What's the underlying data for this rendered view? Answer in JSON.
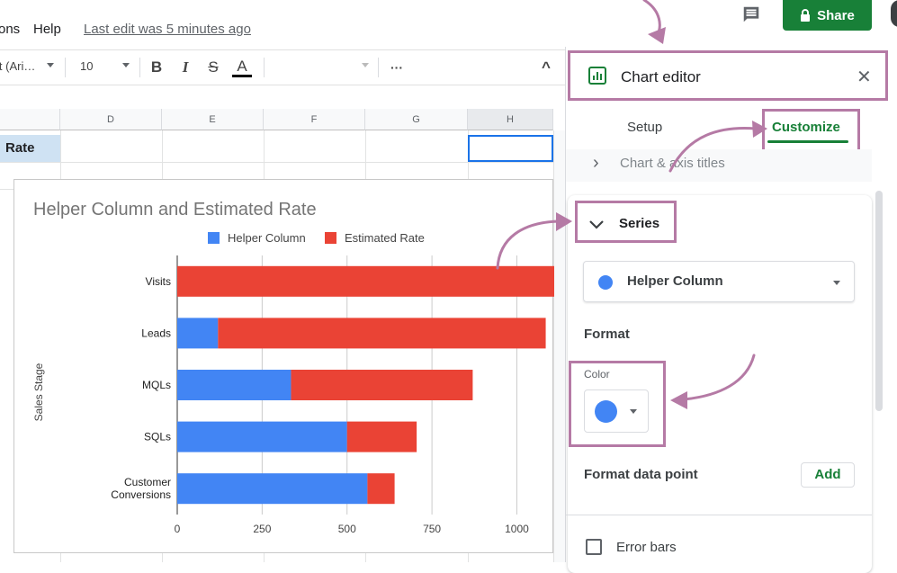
{
  "menu": {
    "item_ons": "ons",
    "item_help": "Help",
    "last_edit": "Last edit was 5 minutes ago"
  },
  "header": {
    "share_label": "Share"
  },
  "toolbar": {
    "font": "lt (Ari…",
    "size": "10",
    "bold": "B",
    "italic": "I",
    "strike": "S",
    "text_color": "A",
    "more": "···",
    "collapse": "^"
  },
  "columns": [
    "D",
    "E",
    "F",
    "G",
    "H"
  ],
  "cell_rate": "Rate",
  "chart_data": {
    "type": "bar",
    "title": "Helper Column and Estimated Rate",
    "ylabel": "Sales Stage",
    "categories": [
      "Visits",
      "Leads",
      "MQLs",
      "SQLs",
      "Customer Conversions"
    ],
    "category_lines": [
      [
        "Visits"
      ],
      [
        "Leads"
      ],
      [
        "MQLs"
      ],
      [
        "SQLs"
      ],
      [
        "Customer",
        "Conversions"
      ]
    ],
    "series": [
      {
        "name": "Helper Column",
        "color": "#4285f4",
        "values": [
          0,
          120,
          335,
          500,
          560
        ]
      },
      {
        "name": "Estimated Rate",
        "color": "#ea4335",
        "values": [
          1110,
          965,
          535,
          205,
          80
        ]
      }
    ],
    "xlim": [
      0,
      1110
    ],
    "xticks": [
      0,
      250,
      500,
      750,
      1000
    ],
    "xtick_labels": [
      "0",
      "250",
      "500",
      "750",
      "1000"
    ],
    "stacked": true,
    "legend": "top",
    "grid": true
  },
  "editor": {
    "title": "Chart editor",
    "tab_setup": "Setup",
    "tab_customize": "Customize",
    "section_chart_axis": "Chart & axis titles",
    "section_series": "Series",
    "series_selected": "Helper Column",
    "series_color": "#4285f4",
    "format_label": "Format",
    "color_label": "Color",
    "format_data_point": "Format data point",
    "add_label": "Add",
    "error_bars": "Error bars"
  },
  "accent": "#188038",
  "highlight": "#b57aa5"
}
